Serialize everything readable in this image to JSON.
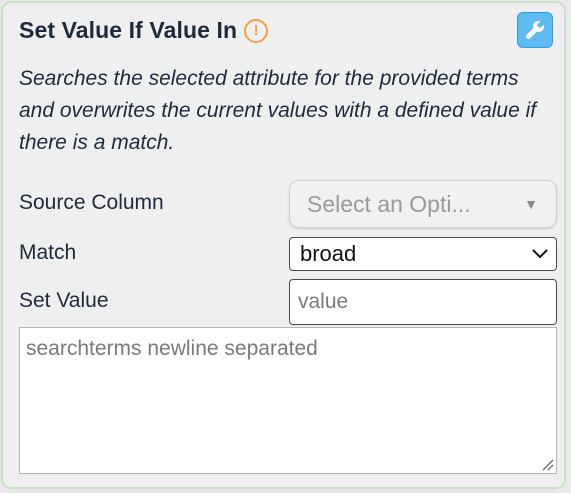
{
  "node": {
    "title": "Set Value If Value In",
    "warning_icon": "exclamation-circle-icon",
    "warning_glyph": "!",
    "tool_icon": "wrench-icon",
    "description": "Searches the selected attribute for the provided terms and overwrites the current values with a defined value if there is a match.",
    "accent_color": "#5ebcf0",
    "warning_color": "#f0a14b",
    "border_color": "#c9e2c6"
  },
  "fields": {
    "source_column": {
      "label": "Source Column",
      "value": "Select an Opti..."
    },
    "match": {
      "label": "Match",
      "value": "broad"
    },
    "set_value": {
      "label": "Set Value",
      "value": "",
      "placeholder": "value"
    },
    "search_terms": {
      "value": "",
      "placeholder": "searchterms newline separated"
    }
  }
}
